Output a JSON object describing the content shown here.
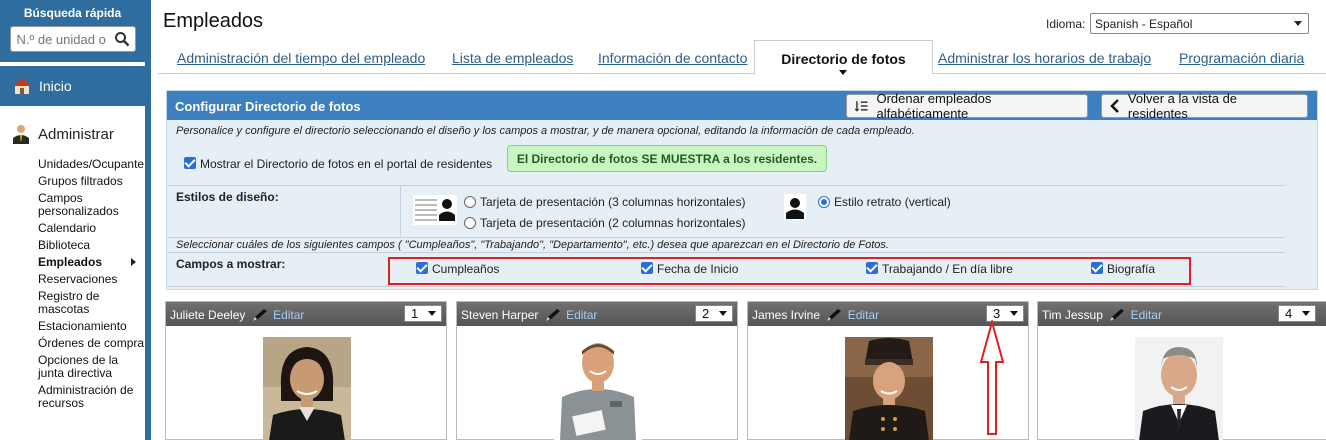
{
  "sidebar": {
    "quick_search_title": "Búsqueda rápida",
    "quick_search_placeholder": "N.º de unidad o",
    "home_label": "Inicio",
    "admin_label": "Administrar",
    "items": [
      {
        "label": "Unidades/Ocupante"
      },
      {
        "label": "Grupos filtrados"
      },
      {
        "label": "Campos personalizados"
      },
      {
        "label": "Calendario"
      },
      {
        "label": "Biblioteca"
      },
      {
        "label": "Empleados",
        "active": true
      },
      {
        "label": "Reservaciones"
      },
      {
        "label": "Registro de mascotas"
      },
      {
        "label": "Estacionamiento"
      },
      {
        "label": "Órdenes de compra"
      },
      {
        "label": "Opciones de la junta directiva"
      },
      {
        "label": "Administración de recursos"
      }
    ]
  },
  "header": {
    "title": "Empleados",
    "language_label": "Idioma:",
    "language_value": "Spanish - Español"
  },
  "tabs": [
    {
      "label": "Administración del tiempo del empleado"
    },
    {
      "label": "Lista de empleados"
    },
    {
      "label": "Información de contacto"
    },
    {
      "label": "Directorio de fotos",
      "active": true
    },
    {
      "label": "Administrar los horarios de trabajo"
    },
    {
      "label": "Programación diaria"
    }
  ],
  "config": {
    "title": "Configurar Directorio de fotos",
    "sort_button": "Ordenar empleados alfabéticamente",
    "back_button": "Volver a la vista de residentes",
    "description": "Personalice y configure el directorio seleccionando el diseño y los campos a mostrar, y de manera opcional, editando la información de cada empleado.",
    "show_label": "Mostrar el Directorio de fotos en el portal de residentes",
    "status_text": "El Directorio de fotos SE MUESTRA a los residentes.",
    "styles_label": "Estilos de diseño:",
    "style_options": [
      "Tarjeta de presentación (3 columnas horizontales)",
      "Tarjeta de presentación (2 columnas horizontales)",
      "Estilo retrato (vertical)"
    ],
    "fields_hint": "Seleccionar cuáles de los siguientes campos ( \"Cumpleaños\", \"Trabajando\", \"Departamento\", etc.) desea que aparezcan en el Directorio de Fotos.",
    "fields_label": "Campos a mostrar:",
    "fields": [
      "Cumpleaños",
      "Fecha de Inicio",
      "Trabajando / En día libre",
      "Biografía"
    ]
  },
  "employees": [
    {
      "name": "Juliete Deeley",
      "edit": "Editar",
      "order": "1"
    },
    {
      "name": "Steven Harper",
      "edit": "Editar",
      "order": "2"
    },
    {
      "name": "James Irvine",
      "edit": "Editar",
      "order": "3"
    },
    {
      "name": "Tim Jessup",
      "edit": "Editar",
      "order": "4"
    }
  ],
  "colors": {
    "brand_blue": "#2e6d9e",
    "panel_header": "#3d7fbf",
    "highlight_red": "#e02020",
    "status_green": "#c9f5c2"
  }
}
